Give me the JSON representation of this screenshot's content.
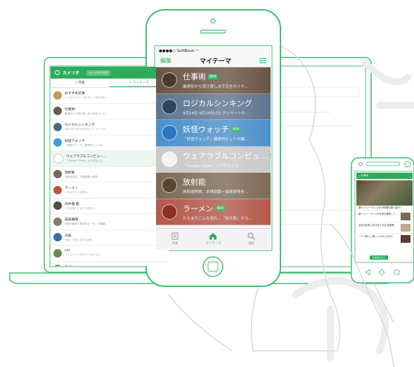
{
  "colors": {
    "accent": "#2eab5d",
    "line": "#3fbf6f",
    "hand": "#e7e7e7"
  },
  "laptop": {
    "brand": "カメリオ",
    "theme_pill": "テーマをさがす",
    "tabs": [
      {
        "label": "特集",
        "icon": "bookmark-icon"
      },
      {
        "label": "マイテーマ",
        "icon": "home-icon"
      }
    ],
    "rows": [
      {
        "title": "おすすめ記事",
        "sub": "たっぷりとテーマのホットなPickを…",
        "time": "",
        "color": "#c79a55"
      },
      {
        "title": "仕事術",
        "sub": "最適化から受け渡しまで完全ガイド…",
        "time": "",
        "color": "#6b5a4c"
      },
      {
        "title": "ロジカルシンキング",
        "sub": "9月14日 9月14日(日) ディベートの…",
        "time": "",
        "color": "#4a6a8a"
      },
      {
        "title": "妖怪ウォッチ",
        "sub": "「妖怪ウォッチ」爆発的ヒットの…",
        "time": "",
        "color": "#3f9bd6"
      },
      {
        "title": "ウェアラブルコンピュー…",
        "sub": "「Google Glass」より切なんな…",
        "time": "",
        "color": "#ffffff"
      },
      {
        "title": "放射能",
        "sub": "放射能物質、本格始動＝福島…",
        "time": "",
        "color": "#7a6a55"
      },
      {
        "title": "ラーメン",
        "sub": "たちまちこんな流れ…",
        "time": "",
        "color": "#b8573a"
      },
      {
        "title": "肉中酒 脂",
        "sub": "ムサを捕ってまた次を待つ…",
        "time": "",
        "color": "#554c44"
      },
      {
        "title": "成長戦略",
        "sub": "成長の戦略と基本的な「を」が重要…",
        "time": "",
        "color": "#8a7a66"
      },
      {
        "title": "天気",
        "sub": "天気、今日とあすは天気…",
        "time": "",
        "color": "#3d6d9a"
      },
      {
        "title": "DIY",
        "sub": "ルアルバイト方をつくるかつた…",
        "time": "",
        "color": "#6c8a4a"
      },
      {
        "title": "デザイン",
        "sub": "iPhone 6の光学で新たなデザイン…",
        "time": "",
        "color": "#9a8a7a"
      },
      {
        "title": "iPhone",
        "sub": "",
        "time": "",
        "color": "#444444"
      }
    ]
  },
  "phone": {
    "carrier": "●●●●○ SoftBank",
    "nav": {
      "edit": "編集",
      "title": "マイテーマ"
    },
    "rows": [
      {
        "title": "仕事術",
        "new": true,
        "sub": "最適化から受け渡しまで完全ガイド…",
        "bg": "#6b5445",
        "icon": "#4a3a2e"
      },
      {
        "title": "ロジカルシンキング",
        "new": false,
        "sub": "9月14日 9月14日(日) ディベートの…",
        "bg": "#5f7490",
        "icon": "#2b4560"
      },
      {
        "title": "妖怪ウォッチ",
        "new": true,
        "sub": "「妖怪ウォッチ」爆発的ヒットの裏…",
        "bg": "#4a8fcb",
        "icon": "#2b78c2"
      },
      {
        "title": "ウェアラブルコンピュ…",
        "new": true,
        "sub": "「Google Glass」より切なんな…",
        "bg": "#c9c9c9",
        "icon": "#f4f4f4"
      },
      {
        "title": "放射能",
        "new": false,
        "sub": "放射能物質、本格始動＝福島原発を…",
        "bg": "#7d6a58",
        "icon": "#5a4535"
      },
      {
        "title": "ラーメン",
        "new": true,
        "sub": "たちまちこんな流れ…「桂大郎」から…",
        "bg": "#b3584a",
        "icon": "#8a3020"
      }
    ],
    "new_label": "NEW",
    "tabbar": [
      {
        "label": "特集",
        "icon": "bookmark-icon"
      },
      {
        "label": "マイテーマ",
        "icon": "home-icon"
      },
      {
        "label": "検索",
        "icon": "search-icon"
      }
    ]
  },
  "android": {
    "bar_title": "仕事術",
    "headline": "新人フリーランスの1年間を振り返り！",
    "items": [
      "新人フリーランスが仕事を獲得して…",
      "会社が仕事に向き合う方法 新常識",
      "一人で寂しい思いしかない日々に"
    ],
    "button": "仕事術を見る"
  }
}
